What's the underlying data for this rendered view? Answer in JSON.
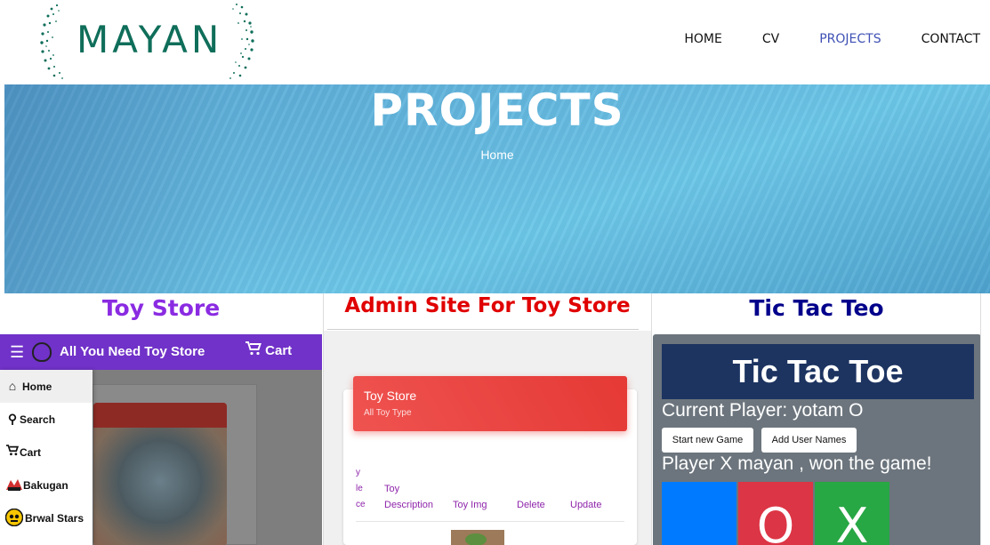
{
  "logo": {
    "text": "MAYAN"
  },
  "nav": [
    {
      "label": "HOME"
    },
    {
      "label": "CV"
    },
    {
      "label": "PROJECTS",
      "active": true
    },
    {
      "label": "CONTACT"
    }
  ],
  "hero": {
    "title": "PROJECTS",
    "breadcrumb": "Home"
  },
  "projects": [
    {
      "title": "Toy Store",
      "title_color": "#8a2be2",
      "preview": {
        "app_title": "All You Need Toy Store",
        "cart_label": "Cart",
        "drawer_items": [
          {
            "label": "Home",
            "icon": "home-icon"
          },
          {
            "label": "Search",
            "icon": "search-icon"
          },
          {
            "label": "Cart",
            "icon": "cart-icon"
          },
          {
            "label": "Bakugan",
            "icon": "bakugan-icon"
          },
          {
            "label": "Brwal Stars",
            "icon": "brawl-stars-icon"
          }
        ]
      }
    },
    {
      "title": "Admin Site For Toy Store",
      "title_color": "#e00000",
      "preview": {
        "card_title": "Toy Store",
        "card_subtitle": "All Toy Type",
        "cut_column": [
          "y",
          "le",
          "ce"
        ],
        "columns": [
          {
            "lines": [
              "Toy",
              "Description"
            ]
          },
          {
            "lines": [
              "Toy Img"
            ]
          },
          {
            "lines": [
              "Delete"
            ]
          },
          {
            "lines": [
              "Update"
            ]
          }
        ]
      }
    },
    {
      "title": "Tic Tac Teo",
      "title_color": "#00008b",
      "preview": {
        "header": "Tic Tac Toe",
        "current_player": "Current Player: yotam O",
        "buttons": [
          "Start new Game",
          "Add User Names"
        ],
        "result": "Player X mayan , won the game!",
        "cells": [
          {
            "mark": "",
            "color": "#007bff"
          },
          {
            "mark": "O",
            "color": "#dc3545"
          },
          {
            "mark": "X",
            "color": "#28a745"
          }
        ]
      }
    }
  ],
  "colors": {
    "accent_nav": "#3f51b5",
    "toy_bar": "#7032c8",
    "admin_header": "#e53935",
    "ttt_header": "#1d3461"
  }
}
